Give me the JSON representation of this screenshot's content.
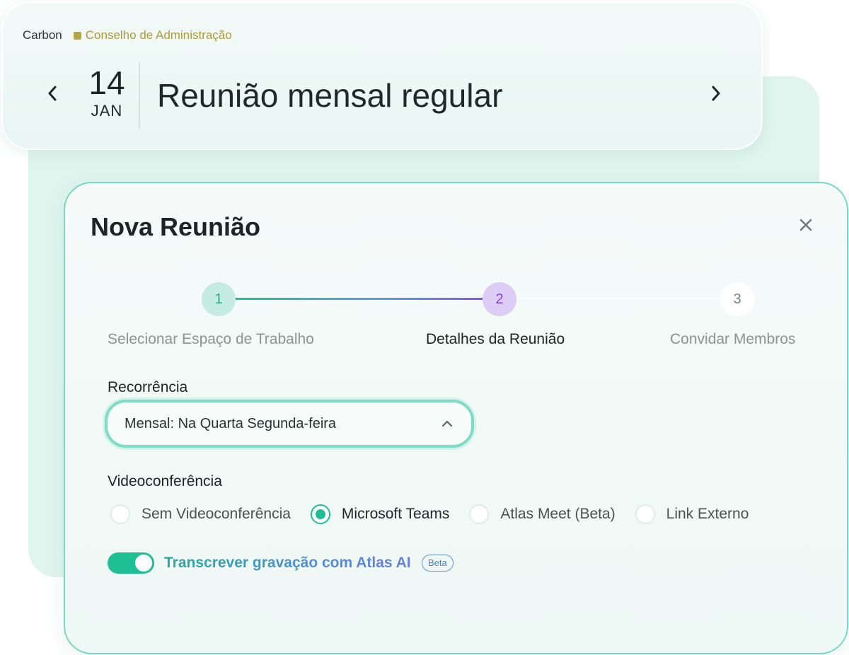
{
  "header": {
    "breadcrumb_root": "Carbon",
    "breadcrumb_org": "Conselho de Administração",
    "date_day": "14",
    "date_month": "JAN",
    "meeting_title": "Reunião mensal regular",
    "org_color": "#b5a549"
  },
  "modal": {
    "title": "Nova Reunião",
    "steps": [
      {
        "number": "1",
        "label": "Selecionar Espaço de Trabalho",
        "state": "completed"
      },
      {
        "number": "2",
        "label": "Detalhes da Reunião",
        "state": "active"
      },
      {
        "number": "3",
        "label": "Convidar Membros",
        "state": "pending"
      }
    ],
    "recurrence": {
      "label": "Recorrência",
      "value": "Mensal: Na Quarta Segunda-feira"
    },
    "videoconference": {
      "label": "Videoconferência",
      "options": [
        "Sem Videoconferência",
        "Microsoft Teams",
        "Atlas Meet (Beta)",
        "Link Externo"
      ],
      "selected": "Microsoft Teams"
    },
    "transcription": {
      "label": "Transcrever gravação com Atlas AI",
      "badge": "Beta",
      "enabled": true
    }
  },
  "colors": {
    "accent": "#1fbf95",
    "step_active": "#8a3fe0",
    "border": "#76d9bf"
  }
}
